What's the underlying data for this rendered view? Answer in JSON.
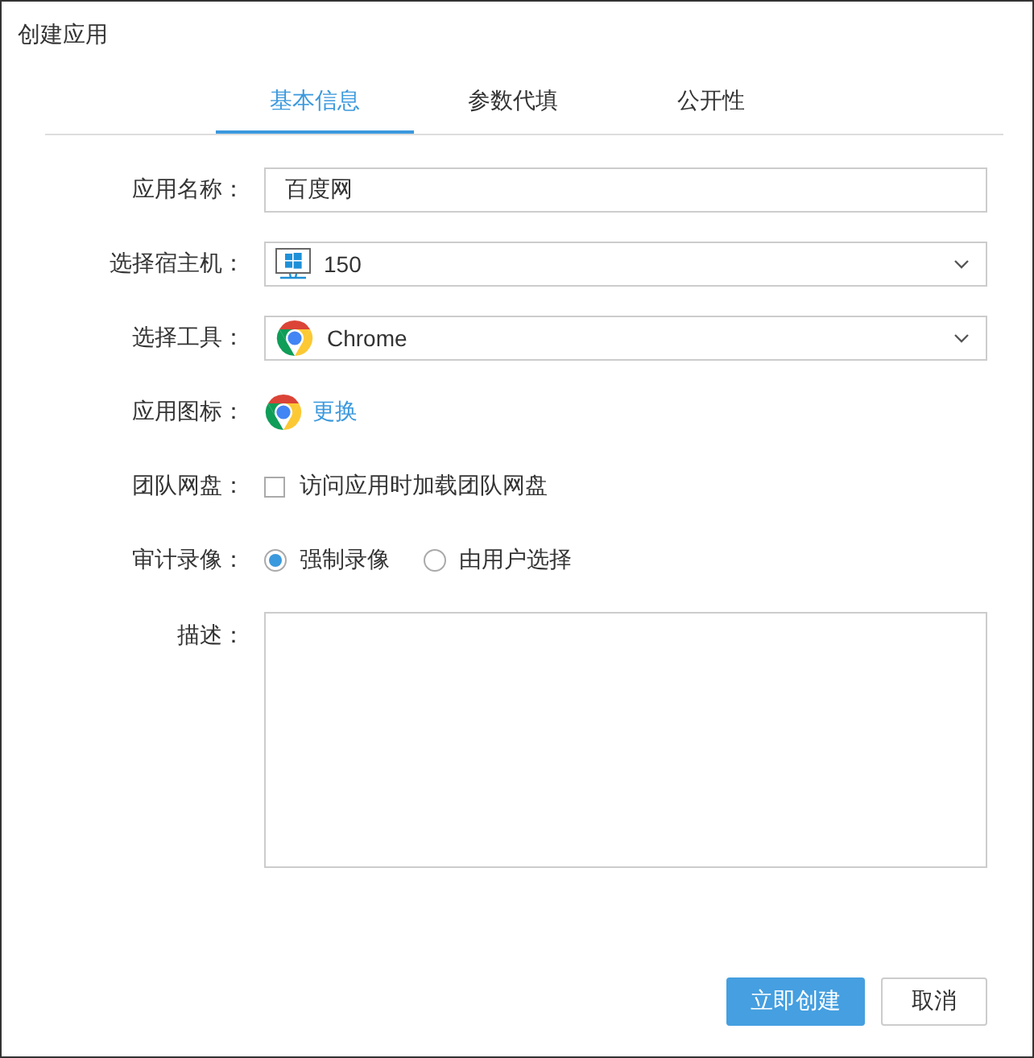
{
  "window": {
    "title": "创建应用"
  },
  "tabs": [
    {
      "label": "基本信息",
      "selected": true
    },
    {
      "label": "参数代填",
      "selected": false
    },
    {
      "label": "公开性",
      "selected": false
    }
  ],
  "form": {
    "fields": [
      {
        "kind": "text",
        "label": "应用名称：",
        "value": "百度网"
      },
      {
        "kind": "host-select",
        "label": "选择宿主机：",
        "value": "150"
      },
      {
        "kind": "tool-select",
        "label": "选择工具：",
        "value": "Chrome"
      },
      {
        "kind": "icon-picker",
        "label": "应用图标：",
        "link": "更换"
      },
      {
        "kind": "checkbox",
        "label": "团队网盘：",
        "options": [
          {
            "text": "访问应用时加载团队网盘",
            "checked": false
          }
        ]
      },
      {
        "kind": "radio",
        "label": "审计录像：",
        "options": [
          {
            "text": "强制录像",
            "selected": true
          },
          {
            "text": "由用户选择",
            "selected": false
          }
        ]
      },
      {
        "kind": "textarea",
        "label": "描述："
      }
    ]
  },
  "buttons": [
    {
      "label": "立即创建",
      "kind": "primary"
    },
    {
      "label": "取消",
      "kind": "default"
    }
  ]
}
